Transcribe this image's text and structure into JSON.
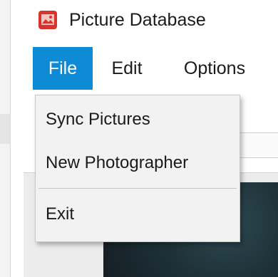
{
  "window": {
    "title": "Picture Database",
    "icon": "picture-icon"
  },
  "menubar": {
    "items": [
      {
        "label": "File",
        "active": true
      },
      {
        "label": "Edit",
        "active": false
      },
      {
        "label": "Options",
        "active": false
      }
    ]
  },
  "file_menu": {
    "items": [
      {
        "label": "Sync Pictures"
      },
      {
        "label": "New Photographer"
      },
      {
        "label": "Exit"
      }
    ]
  },
  "colors": {
    "accent": "#0f8bd6",
    "icon_red": "#d9342b"
  }
}
